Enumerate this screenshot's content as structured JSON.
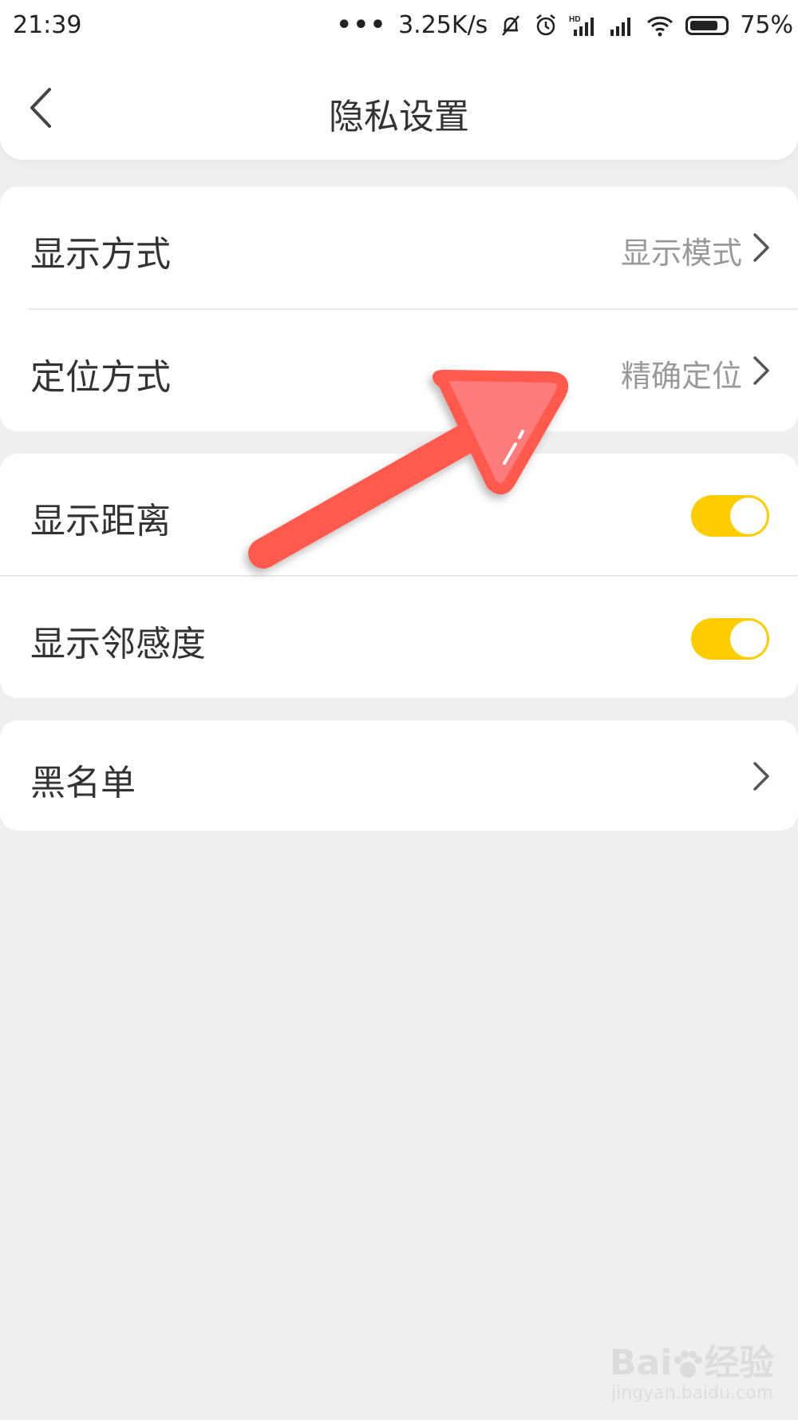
{
  "status_bar": {
    "time": "21:39",
    "dots": "•••",
    "network_speed": "3.25K/s",
    "hd_label": "HD",
    "battery_percent": "75%",
    "icons": [
      "mute-bell-icon",
      "alarm-icon",
      "signal-hd-icon",
      "signal-icon",
      "wifi-icon",
      "battery-icon"
    ]
  },
  "header": {
    "title": "隐私设置",
    "back_icon": "back-chevron-icon"
  },
  "sections": {
    "display_mode": {
      "label": "显示方式",
      "value": "显示模式"
    },
    "location_mode": {
      "label": "定位方式",
      "value": "精确定位"
    },
    "show_distance": {
      "label": "显示距离",
      "toggle_on": true
    },
    "show_proximity": {
      "label": "显示邻感度",
      "toggle_on": true
    },
    "blacklist": {
      "label": "黑名单"
    }
  },
  "colors": {
    "toggle_on": "#ffcc00",
    "annotation_arrow": "#ff5a4e",
    "background": "#efefef"
  },
  "watermark": {
    "brand_prefix": "Bai",
    "brand_suffix": "经验",
    "url": "jingyan.baidu.com"
  }
}
